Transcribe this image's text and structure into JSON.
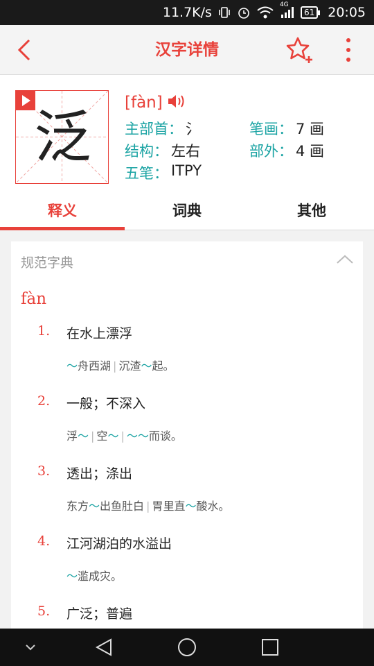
{
  "status_bar": {
    "speed": "11.7K/s",
    "network": "4G",
    "battery": "61",
    "time": "20:05"
  },
  "header": {
    "title": "汉字详情"
  },
  "character": {
    "glyph": "泛",
    "pinyin": "[fàn]",
    "radical_label": "主部首：",
    "radical_value": "氵",
    "strokes_label": "笔画：",
    "strokes_value": "7 画",
    "structure_label": "结构：",
    "structure_value": "左右",
    "outer_label": "部外：",
    "outer_value": "4 画",
    "wubi_label": "五笔：",
    "wubi_value": "ITPY"
  },
  "tabs": [
    {
      "label": "释义",
      "active": true
    },
    {
      "label": "词典",
      "active": false
    },
    {
      "label": "其他",
      "active": false
    }
  ],
  "dictionary": {
    "source": "规范字典",
    "pinyin": "fàn",
    "definitions": [
      {
        "num": "1.",
        "meaning": "在水上漂浮",
        "example": [
          {
            "t": "～",
            "k": "tilde"
          },
          {
            "t": "舟西湖",
            "k": "text"
          },
          {
            "t": "|",
            "k": "sep"
          },
          {
            "t": "沉渣",
            "k": "text"
          },
          {
            "t": "～",
            "k": "tilde"
          },
          {
            "t": "起。",
            "k": "text"
          }
        ]
      },
      {
        "num": "2.",
        "meaning": "一般；不深入",
        "example": [
          {
            "t": "浮",
            "k": "text"
          },
          {
            "t": "～",
            "k": "tilde"
          },
          {
            "t": "|",
            "k": "sep"
          },
          {
            "t": "空",
            "k": "text"
          },
          {
            "t": "～",
            "k": "tilde"
          },
          {
            "t": "|",
            "k": "sep"
          },
          {
            "t": "～～",
            "k": "tilde"
          },
          {
            "t": "而谈。",
            "k": "text"
          }
        ]
      },
      {
        "num": "3.",
        "meaning": "透出；涤出",
        "example": [
          {
            "t": "东方",
            "k": "text"
          },
          {
            "t": "～",
            "k": "tilde"
          },
          {
            "t": "出鱼肚白",
            "k": "text"
          },
          {
            "t": "|",
            "k": "sep"
          },
          {
            "t": "胃里直",
            "k": "text"
          },
          {
            "t": "～",
            "k": "tilde"
          },
          {
            "t": "酸水。",
            "k": "text"
          }
        ]
      },
      {
        "num": "4.",
        "meaning": "江河湖泊的水溢出",
        "example": [
          {
            "t": "～",
            "k": "tilde"
          },
          {
            "t": "滥成灾。",
            "k": "text"
          }
        ]
      },
      {
        "num": "5.",
        "meaning": "广泛；普遍",
        "example": []
      }
    ]
  },
  "colors": {
    "accent": "#e8413a",
    "label_teal": "#1aa3a3"
  }
}
